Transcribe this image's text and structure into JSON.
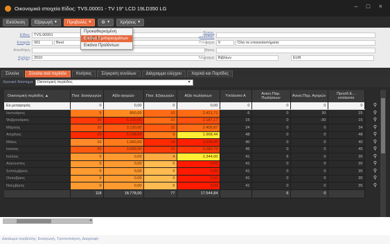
{
  "window": {
    "title": "Οικονομικά στοιχεία Είδος: TVS.00001 - TV 19'' LCD 19LD350 LG",
    "controls": "– □ ×"
  },
  "toolbar": {
    "buttons": [
      "Εκτέλεση",
      "Εξαγωγή",
      "Προβολές",
      "⚙",
      "Χρήσεις"
    ]
  },
  "menu": {
    "items": [
      "Προκαθορισμένη Προβολή",
      "Εικόνα Εμπορευμάτων",
      "Εικόνα Προϊόντων"
    ],
    "highlighted": 1
  },
  "form": {
    "labels": [
      "Είδος",
      "Εταιρία",
      "Αποθήκη",
      "Χρήση",
      "Τύπος μονάδας",
      "Υποκ/μα",
      "Θέση",
      "Νόμισμα"
    ],
    "values": {
      "item": "TVS.00001",
      "company": "001",
      "company_text": "Best",
      "year": "2010",
      "branch_code": "0",
      "branch_name": "Όλα τα υποκαταστήματα",
      "ledger": "Βιβλίων",
      "currency": "EUR"
    }
  },
  "tabs": [
    "Σύνολα",
    "Σύνολα ανά περίοδο",
    "Κινήσεις",
    "Σύγκριση συνόλων",
    "Διάγραμμα ελέγχου",
    "Χαρ/κά και Παρτίδες"
  ],
  "active_tab": 1,
  "filter": {
    "label": "Χρονικό διάστημα",
    "value": "Οικονομική περίοδος"
  },
  "columns": [
    "Οικονομική περίοδος",
    "Ποσ. Εισαγωγών",
    "Αξία αγορών",
    "Ποσ. Εξαγωγών",
    "Αξία πωλήσεων",
    "Υπόλοιπο Α",
    "Ανεκτ.Παρ. Πωλήσεων",
    "Ανεκτ.Παρ. Αγορών",
    "Προσδ.Ε... υπόλοιπο"
  ],
  "sort_indicator": "▲",
  "rows": [
    [
      "Εκ μεταφοράς",
      "0",
      "0,00",
      "0",
      "0,00",
      "0",
      "0",
      "0",
      "0"
    ],
    [
      "Ιανουάριος",
      "5",
      "850,00",
      "10",
      "2.421,71",
      "-5",
      "0",
      "30",
      "25"
    ],
    [
      "Φεβρουάριος",
      "30",
      "5.100,00",
      "10",
      "2.187,17",
      "15",
      "0",
      "-30",
      "15"
    ],
    [
      "Μάρτιος",
      "20",
      "3.120,00",
      "11",
      "2.405,87",
      "24",
      "0",
      "0",
      "34"
    ],
    [
      "Απρίλιος",
      "33",
      "5.148,00",
      "9",
      "1.968,44",
      "48",
      "0",
      "0",
      "48"
    ],
    [
      "Μάιος",
      "10",
      "1.560,00",
      "18",
      "3.936,89",
      "40",
      "0",
      "0",
      "40"
    ],
    [
      "Ιούνιος",
      "20",
      "3.000,00",
      "15",
      "3.280,75",
      "45",
      "0",
      "0",
      "45"
    ],
    [
      "Ιούλιος",
      "0",
      "0,00",
      "4",
      "1.344,00",
      "41",
      "6",
      "0",
      "35"
    ],
    [
      "Αύγουστος",
      "0",
      "0,00",
      "0",
      "0,00",
      "41",
      "0",
      "0",
      "35"
    ],
    [
      "Σεπτέμβριος",
      "0",
      "0,00",
      "0",
      "0,00",
      "41",
      "0",
      "0",
      "35"
    ],
    [
      "Οκτώβριος",
      "0",
      "0,00",
      "0",
      "0,00",
      "41",
      "0",
      "0",
      "35"
    ],
    [
      "Νοέμβριος",
      "0",
      "0,00",
      "0",
      "0,00",
      "41",
      "0",
      "0",
      "35"
    ]
  ],
  "totals": [
    "",
    "118",
    "18.778,00",
    "77",
    "17.544,84",
    "",
    "6",
    "0",
    ""
  ],
  "cell_colors": {
    "col1": [
      "#f4f4f4",
      "#ff7a1a",
      "#ff3a08",
      "#ff5a10",
      "#ff2a00",
      "#ff8a2a",
      "#ff5a10",
      "#ff9a30",
      "#ff9a30",
      "#ff9a30",
      "#ff9a30",
      "#ff9a30"
    ],
    "col2": [
      "#f4f4f4",
      "#ff8a20",
      "#ff2a00",
      "#ff5a10",
      "#ff2a00",
      "#ff7a1a",
      "#ff5a10",
      "#ff9a30",
      "#ff9a30",
      "#ff9a30",
      "#ff9a30",
      "#ff9a30"
    ],
    "col3": [
      "#f4f4f4",
      "#ff6a14",
      "#ff6a14",
      "#ff5a10",
      "#ff7a1a",
      "#ff2a00",
      "#ff3a08",
      "#ffaa40",
      "#ffbb50",
      "#ffbb50",
      "#ffbb50",
      "#ffbb50"
    ],
    "col4": [
      "#f4f4f4",
      "#ff6a14",
      "#ff5010",
      "#ff6a14",
      "#ffee33",
      "#ff2000",
      "#ff3a08",
      "#ffee33",
      "#ff1a00",
      "#ff1a00",
      "#ff1a00",
      "#ff1a00"
    ]
  },
  "status": "Δικαίωμα προβολής: Εισαγωγή, Τροποποίηση, Διαγραφή"
}
